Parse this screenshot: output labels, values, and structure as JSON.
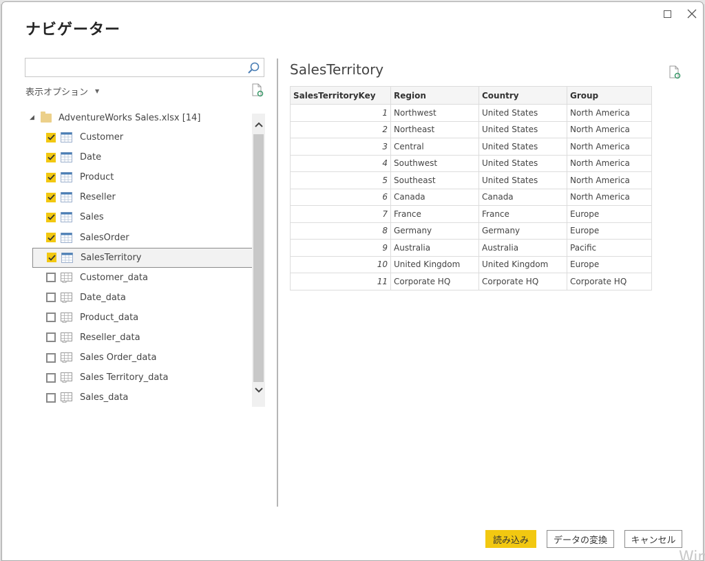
{
  "dialog": {
    "title": "ナビゲーター",
    "window_controls": {
      "maximize": "maximize",
      "close": "close"
    }
  },
  "left_pane": {
    "search": {
      "value": "",
      "placeholder": ""
    },
    "view_options_label": "表示オプション",
    "tree": {
      "root_label": "AdventureWorks Sales.xlsx [14]",
      "items": [
        {
          "label": "Customer",
          "checked": true,
          "kind": "table",
          "selected": false
        },
        {
          "label": "Date",
          "checked": true,
          "kind": "table",
          "selected": false
        },
        {
          "label": "Product",
          "checked": true,
          "kind": "table",
          "selected": false
        },
        {
          "label": "Reseller",
          "checked": true,
          "kind": "table",
          "selected": false
        },
        {
          "label": "Sales",
          "checked": true,
          "kind": "table",
          "selected": false
        },
        {
          "label": "SalesOrder",
          "checked": true,
          "kind": "table",
          "selected": false
        },
        {
          "label": "SalesTerritory",
          "checked": true,
          "kind": "table",
          "selected": true
        },
        {
          "label": "Customer_data",
          "checked": false,
          "kind": "sheet",
          "selected": false
        },
        {
          "label": "Date_data",
          "checked": false,
          "kind": "sheet",
          "selected": false
        },
        {
          "label": "Product_data",
          "checked": false,
          "kind": "sheet",
          "selected": false
        },
        {
          "label": "Reseller_data",
          "checked": false,
          "kind": "sheet",
          "selected": false
        },
        {
          "label": "Sales Order_data",
          "checked": false,
          "kind": "sheet",
          "selected": false
        },
        {
          "label": "Sales Territory_data",
          "checked": false,
          "kind": "sheet",
          "selected": false
        },
        {
          "label": "Sales_data",
          "checked": false,
          "kind": "sheet",
          "selected": false
        }
      ]
    }
  },
  "preview": {
    "title": "SalesTerritory",
    "columns": [
      "SalesTerritoryKey",
      "Region",
      "Country",
      "Group"
    ],
    "rows": [
      [
        "1",
        "Northwest",
        "United States",
        "North America"
      ],
      [
        "2",
        "Northeast",
        "United States",
        "North America"
      ],
      [
        "3",
        "Central",
        "United States",
        "North America"
      ],
      [
        "4",
        "Southwest",
        "United States",
        "North America"
      ],
      [
        "5",
        "Southeast",
        "United States",
        "North America"
      ],
      [
        "6",
        "Canada",
        "Canada",
        "North America"
      ],
      [
        "7",
        "France",
        "France",
        "Europe"
      ],
      [
        "8",
        "Germany",
        "Germany",
        "Europe"
      ],
      [
        "9",
        "Australia",
        "Australia",
        "Pacific"
      ],
      [
        "10",
        "United Kingdom",
        "United Kingdom",
        "Europe"
      ],
      [
        "11",
        "Corporate HQ",
        "Corporate HQ",
        "Corporate HQ"
      ]
    ]
  },
  "footer": {
    "load_label": "読み込み",
    "transform_label": "データの変換",
    "cancel_label": "キャンセル"
  },
  "watermark": "Win",
  "colors": {
    "accent": "#f2c811",
    "folder": "#ecd08a",
    "icon_blue": "#4a7eb5"
  }
}
